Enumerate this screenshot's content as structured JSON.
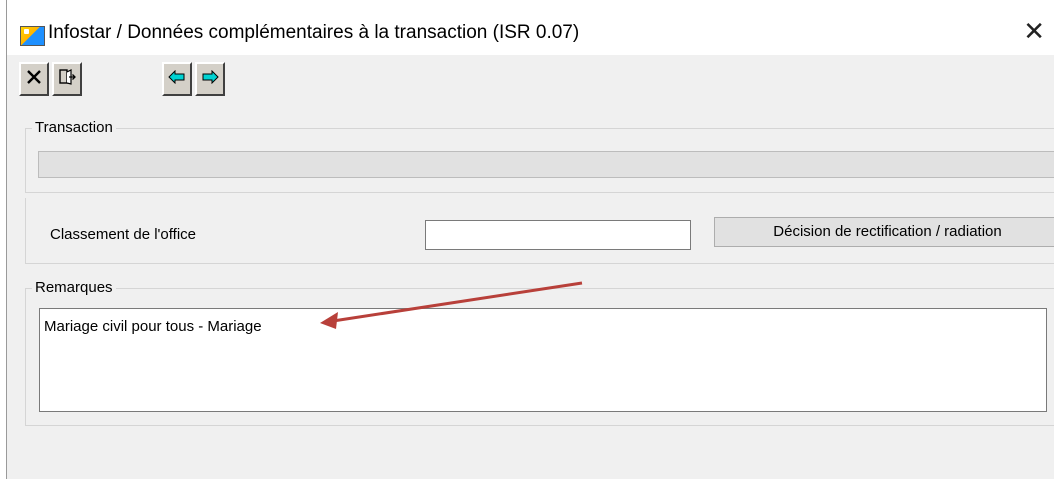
{
  "window": {
    "title": "Infostar / Données complémentaires à la transaction (ISR 0.07)",
    "close_glyph": "✕"
  },
  "toolbar": {
    "buttons": [
      {
        "icon": "close-x-icon"
      },
      {
        "icon": "exit-door-icon"
      },
      {
        "icon": "arrow-left-icon"
      },
      {
        "icon": "arrow-right-icon"
      }
    ],
    "arrow_color": "#00c8c8"
  },
  "transaction": {
    "label": "Transaction",
    "value": ""
  },
  "office": {
    "label": "Classement de l'office",
    "value": "",
    "button_label": "Décision de rectification / radiation"
  },
  "remarks": {
    "label": "Remarques",
    "value": "Mariage civil pour tous - Mariage"
  },
  "annotation": {
    "color": "#b8403a",
    "icon": "pointer-arrow-annotation"
  }
}
